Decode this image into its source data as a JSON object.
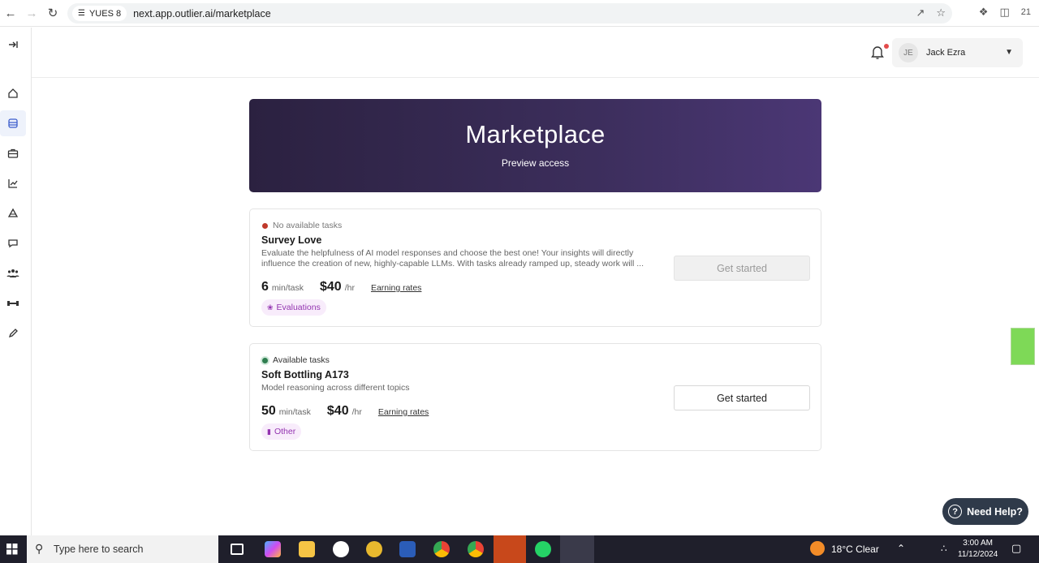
{
  "browser": {
    "site_chip": "YUES 8",
    "url": "next.app.outlier.ai/marketplace",
    "tab_count": "21"
  },
  "header": {
    "user_initials": "JE",
    "user_name": "Jack Ezra"
  },
  "hero": {
    "title": "Marketplace",
    "subtitle": "Preview access"
  },
  "projects": [
    {
      "status": "No available tasks",
      "status_color": "#c0392b",
      "title": "Survey Love",
      "description": "Evaluate the helpfulness of AI model responses and choose the best one! Your insights will directly influence the creation of new, highly-capable LLMs. With tasks already ramped up, steady work will ...",
      "minutes": "6",
      "minutes_unit": "min/task",
      "rate": "$40",
      "rate_unit": "/hr",
      "earning_link": "Earning rates",
      "tag": "Evaluations",
      "button": "Get started",
      "button_enabled": false
    },
    {
      "status": "Available tasks",
      "status_color": "#2e7d4f",
      "title": "Soft Bottling A173",
      "description": "Model reasoning across different topics",
      "minutes": "50",
      "minutes_unit": "min/task",
      "rate": "$40",
      "rate_unit": "/hr",
      "earning_link": "Earning rates",
      "tag": "Other",
      "button": "Get started",
      "button_enabled": true
    }
  ],
  "help": {
    "label": "Need Help?"
  },
  "taskbar": {
    "search_placeholder": "Type here to search",
    "weather": "18°C  Clear",
    "time": "3:00 AM",
    "date": "11/12/2024"
  }
}
